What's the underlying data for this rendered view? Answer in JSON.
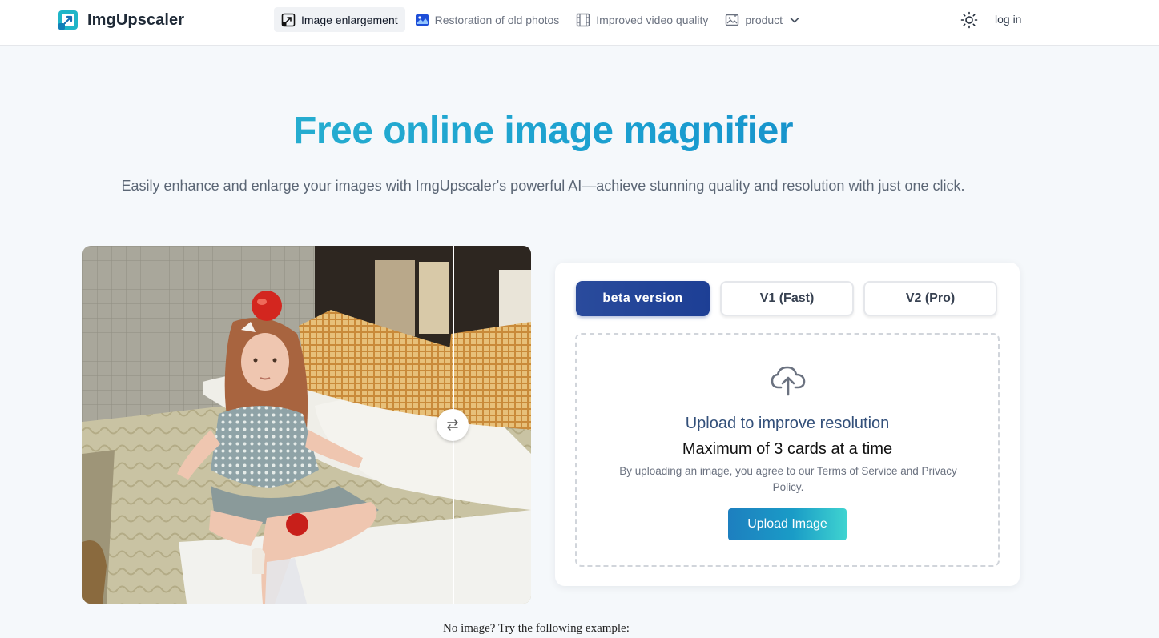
{
  "brand": {
    "name": "ImgUpscaler",
    "accent": "#1a9ed0"
  },
  "nav": {
    "items": [
      {
        "label": "Image enlargement",
        "icon": "image-enlarge-icon",
        "active": true
      },
      {
        "label": "Restoration of old photos",
        "icon": "photo-restore-icon",
        "active": false
      },
      {
        "label": "Improved video quality",
        "icon": "film-icon",
        "active": false
      },
      {
        "label": "product",
        "icon": "image-icon",
        "active": false,
        "has_dropdown": true
      }
    ],
    "theme_icon": "sun-icon",
    "login_label": "log in"
  },
  "hero": {
    "title": "Free online image magnifier",
    "subtitle": "Easily enhance and enlarge your images with ImgUpscaler's powerful AI—achieve stunning quality and resolution with just one click."
  },
  "compare": {
    "before_after_split": 0.83,
    "swap_icon": "swap-arrows-icon"
  },
  "upload_card": {
    "tabs": [
      {
        "label": "beta version",
        "selected": true
      },
      {
        "label": "V1 (Fast)",
        "selected": false
      },
      {
        "label": "V2 (Pro)",
        "selected": false
      }
    ],
    "dropzone": {
      "icon": "cloud-upload-icon",
      "title": "Upload to improve resolution",
      "max_text": "Maximum of 3 cards at a time",
      "terms_text": "By uploading an image, you agree to our Terms of Service and Privacy Policy.",
      "button_label": "Upload Image"
    }
  },
  "example_prompt": "No image? Try the following example:"
}
